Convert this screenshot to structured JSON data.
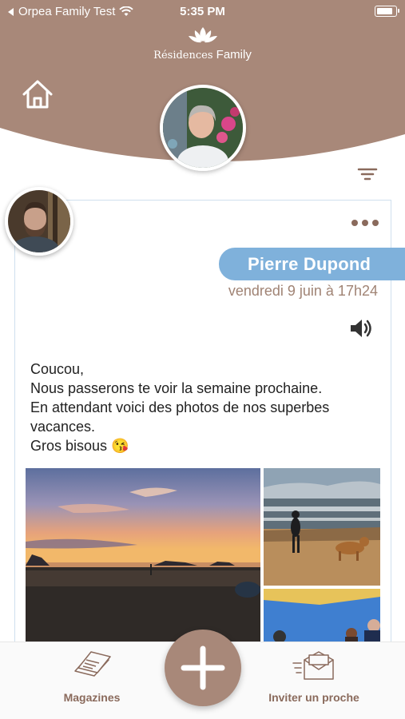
{
  "status_bar": {
    "carrier": "Orpea Family Test",
    "time": "5:35 PM"
  },
  "header": {
    "logo_brand": "Résidences",
    "logo_product": "Family"
  },
  "post": {
    "author_name": "Pierre Dupond",
    "date": "vendredi 9 juin à 17h24",
    "message_lines": [
      "Coucou,",
      "Nous passerons te voir la semaine prochaine.",
      "En attendant voici des photos de nos superbes",
      "vacances.",
      "Gros bisous"
    ],
    "emoji": "😘"
  },
  "tab_bar": {
    "magazines_label": "Magazines",
    "invite_label": "Inviter un proche"
  },
  "colors": {
    "header_brown": "#a88879",
    "accent_blue": "#7fb1db",
    "date_brown": "#a08374",
    "tab_label_brown": "#8a6a5c"
  },
  "icons": [
    "back-arrow-icon",
    "wifi-icon",
    "battery-icon",
    "lotus-logo-icon",
    "home-icon",
    "filter-icon",
    "more-dots-icon",
    "speaker-icon",
    "magazines-icon",
    "plus-icon",
    "invite-envelope-icon"
  ]
}
